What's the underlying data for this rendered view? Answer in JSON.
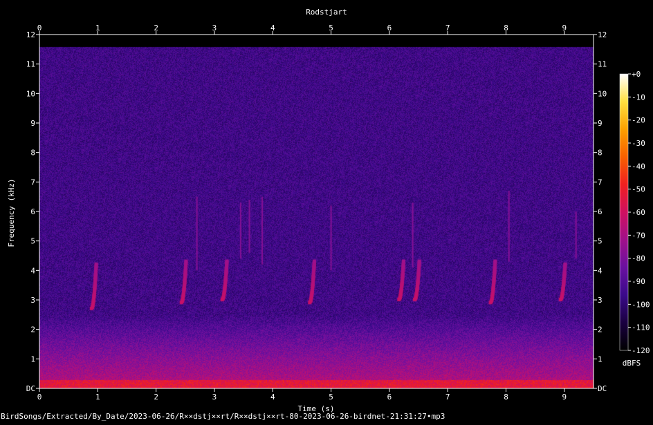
{
  "footer_path": "BirdSongs/Extracted/By_Date/2023-06-26/R××dstj××rt/R××dstj××rt-80-2023-06-26-birdnet-21:31:27•mp3",
  "chart_data": {
    "type": "heatmap",
    "title": "Rodstjart",
    "xlabel": "Time (s)",
    "ylabel": "Frequency (kHz)",
    "xlim": [
      0,
      9.5
    ],
    "ylim": [
      0,
      12
    ],
    "x_ticks": [
      "0",
      "1",
      "2",
      "3",
      "4",
      "5",
      "6",
      "7",
      "8",
      "9"
    ],
    "y_ticks": [
      "DC",
      "1",
      "2",
      "3",
      "4",
      "5",
      "6",
      "7",
      "8",
      "9",
      "10",
      "11",
      "12"
    ],
    "colorbar": {
      "label": "dBFS",
      "range": [
        -120,
        0
      ],
      "ticks": [
        "+0",
        "-10",
        "-20",
        "-30",
        "-40",
        "-50",
        "-60",
        "-70",
        "-80",
        "-90",
        "-100",
        "-110",
        "-120"
      ],
      "colors": [
        "#000000",
        "#1a0040",
        "#3a0a8a",
        "#6a10a0",
        "#a0108a",
        "#d01060",
        "#f02020",
        "#f86000",
        "#fca000",
        "#ffe040",
        "#ffffff"
      ]
    },
    "background_dbfs": -95,
    "low_freq_band": {
      "freq_max_khz": 2.5,
      "dbfs_at_dc": -55
    },
    "calls": [
      {
        "t_start": 0.88,
        "t_end": 0.98,
        "f_low": 2.7,
        "f_high": 4.2
      },
      {
        "t_start": 2.42,
        "t_end": 2.52,
        "f_low": 2.9,
        "f_high": 4.3
      },
      {
        "t_start": 3.12,
        "t_end": 3.22,
        "f_low": 3.0,
        "f_high": 4.3
      },
      {
        "t_start": 4.62,
        "t_end": 4.72,
        "f_low": 2.9,
        "f_high": 4.3
      },
      {
        "t_start": 6.15,
        "t_end": 6.25,
        "f_low": 3.0,
        "f_high": 4.3
      },
      {
        "t_start": 6.42,
        "t_end": 6.52,
        "f_low": 3.0,
        "f_high": 4.3
      },
      {
        "t_start": 7.72,
        "t_end": 7.82,
        "f_low": 2.9,
        "f_high": 4.3
      },
      {
        "t_start": 8.92,
        "t_end": 9.02,
        "f_low": 3.0,
        "f_high": 4.2
      }
    ],
    "tonal_lines": [
      {
        "t": 2.7,
        "f_low": 4.0,
        "f_high": 6.5
      },
      {
        "t": 3.45,
        "f_low": 4.4,
        "f_high": 6.3
      },
      {
        "t": 3.6,
        "f_low": 4.6,
        "f_high": 6.4
      },
      {
        "t": 3.82,
        "f_low": 4.2,
        "f_high": 6.5
      },
      {
        "t": 5.0,
        "f_low": 4.0,
        "f_high": 6.2
      },
      {
        "t": 6.4,
        "f_low": 4.1,
        "f_high": 6.3
      },
      {
        "t": 8.05,
        "f_low": 4.3,
        "f_high": 6.7
      },
      {
        "t": 9.2,
        "f_low": 4.4,
        "f_high": 6.0
      }
    ]
  }
}
